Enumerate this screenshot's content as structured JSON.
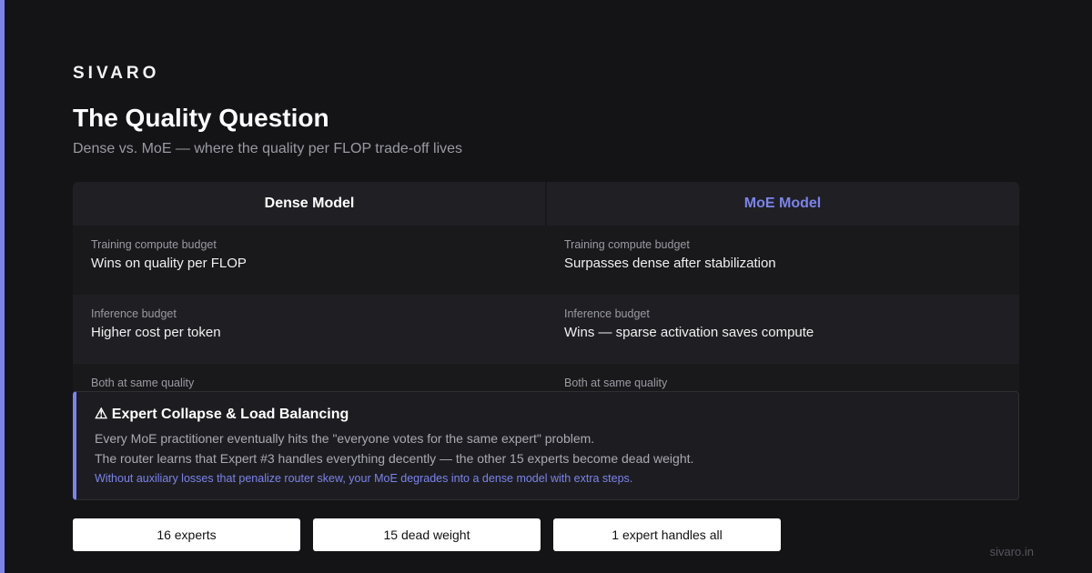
{
  "brand": "SIVARO",
  "title": "The Quality Question",
  "subtitle": "Dense vs. MoE — where the quality per FLOP trade-off lives",
  "colors": {
    "accent": "#7b83eb",
    "background": "#141417"
  },
  "comparison": {
    "columns": [
      "Dense Model",
      "MoE Model"
    ],
    "rows": [
      {
        "dense": {
          "label": "Training compute budget",
          "value": "Wins on quality per FLOP"
        },
        "moe": {
          "label": "Training compute budget",
          "value": "Surpasses dense after stabilization"
        }
      },
      {
        "dense": {
          "label": "Inference budget",
          "value": "Higher cost per token"
        },
        "moe": {
          "label": "Inference budget",
          "value": "Wins — sparse activation saves compute"
        }
      },
      {
        "dense": {
          "label": "Both at same quality",
          "value": ""
        },
        "moe": {
          "label": "Both at same quality",
          "value": ""
        }
      }
    ]
  },
  "callout": {
    "icon": "warning-icon",
    "icon_glyph": "⚠",
    "title": "Expert Collapse & Load Balancing",
    "lines": [
      "Every MoE practitioner eventually hits the \"everyone votes for the same expert\" problem.",
      "The router learns that Expert #3 handles everything decently — the other 15 experts become dead weight."
    ],
    "note": "Without auxiliary losses that penalize router skew, your MoE degrades into a dense model with extra steps."
  },
  "stats": [
    "16 experts",
    "15 dead weight",
    "1 expert handles all"
  ],
  "footer": "sivaro.in"
}
